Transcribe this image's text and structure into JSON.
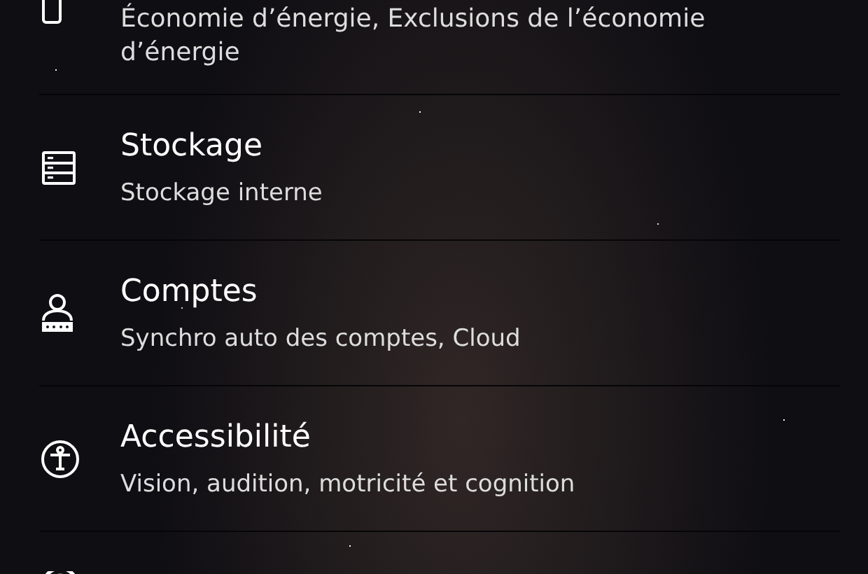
{
  "settings_items": [
    {
      "kind": "phone-outline",
      "subtitle": "Économie d’énergie, Exclusions de l’économie d’énergie"
    },
    {
      "kind": "storage",
      "title": "Stockage",
      "subtitle": "Stockage interne"
    },
    {
      "kind": "account",
      "title": "Comptes",
      "subtitle": "Synchro auto des comptes, Cloud"
    },
    {
      "kind": "accessibility",
      "title": "Accessibilité",
      "subtitle": "Vision, audition, motricité et cognition"
    },
    {
      "kind": "ring-partial"
    }
  ]
}
